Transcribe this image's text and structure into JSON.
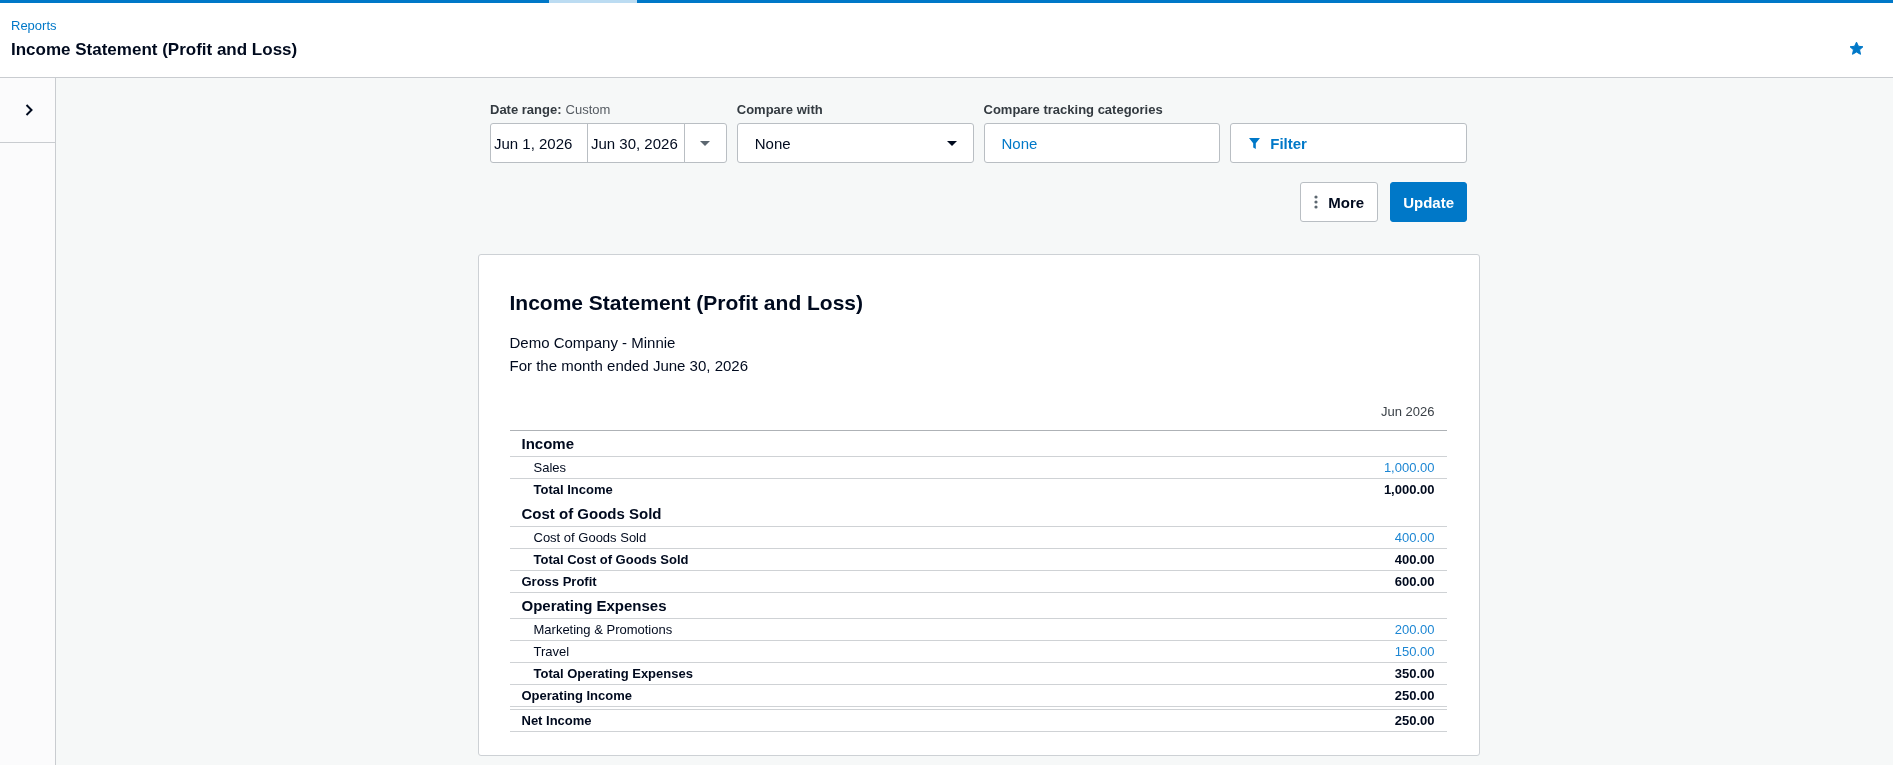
{
  "header": {
    "breadcrumb": "Reports",
    "title": "Income Statement (Profit and Loss)",
    "favorite": true
  },
  "sidebar": {
    "expanded": false
  },
  "filters": {
    "date_range": {
      "label": "Date range:",
      "mode": "Custom",
      "start": "Jun 1, 2026",
      "end": "Jun 30, 2026"
    },
    "compare_with": {
      "label": "Compare with",
      "value": "None"
    },
    "tracking_categories": {
      "label": "Compare tracking categories",
      "value": "None"
    },
    "filter_button": "Filter"
  },
  "actions": [
    {
      "kind": "menu",
      "label": "More"
    },
    {
      "kind": "primary",
      "label": "Update"
    }
  ],
  "report": {
    "title": "Income Statement (Profit and Loss)",
    "company": "Demo Company - Minnie",
    "period": "For the month ended June 30, 2026",
    "column": "Jun 2026",
    "rows": [
      {
        "kind": "section",
        "label": "Income",
        "children": [
          {
            "kind": "account",
            "label": "Sales",
            "value": "1,000.00"
          },
          {
            "kind": "total",
            "label": "Total Income",
            "value": "1,000.00"
          }
        ]
      },
      {
        "kind": "section",
        "label": "Cost of Goods Sold",
        "children": [
          {
            "kind": "account",
            "label": "Cost of Goods Sold",
            "value": "400.00"
          },
          {
            "kind": "total",
            "label": "Total Cost of Goods Sold",
            "value": "400.00"
          }
        ]
      },
      {
        "kind": "summary",
        "label": "Gross Profit",
        "value": "600.00"
      },
      {
        "kind": "section",
        "label": "Operating Expenses",
        "children": [
          {
            "kind": "account",
            "label": "Marketing & Promotions",
            "value": "200.00"
          },
          {
            "kind": "account",
            "label": "Travel",
            "value": "150.00"
          },
          {
            "kind": "total",
            "label": "Total Operating Expenses",
            "value": "350.00"
          }
        ]
      },
      {
        "kind": "summary",
        "label": "Operating Income",
        "value": "250.00"
      },
      {
        "kind": "net",
        "label": "Net Income",
        "value": "250.00"
      }
    ]
  }
}
